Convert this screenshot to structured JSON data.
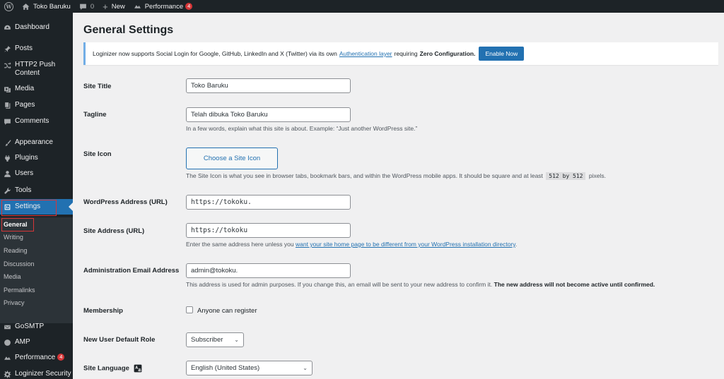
{
  "adminbar": {
    "site_name": "Toko Baruku",
    "comments_count": "0",
    "new_label": "New",
    "performance_label": "Performance",
    "performance_count": "4"
  },
  "sidebar": {
    "dashboard": "Dashboard",
    "posts": "Posts",
    "http2": "HTTP2 Push Content",
    "media": "Media",
    "pages": "Pages",
    "comments": "Comments",
    "appearance": "Appearance",
    "plugins": "Plugins",
    "users": "Users",
    "tools": "Tools",
    "settings": "Settings",
    "submenu": [
      "General",
      "Writing",
      "Reading",
      "Discussion",
      "Media",
      "Permalinks",
      "Privacy"
    ],
    "gosmtp": "GoSMTP",
    "amp": "AMP",
    "performance": "Performance",
    "performance_count": "4",
    "loginizer": "Loginizer Security"
  },
  "page": {
    "title": "General Settings"
  },
  "notice": {
    "text": "Loginizer now supports Social Login for Google, GitHub, LinkedIn and X (Twitter) via its own",
    "link": "Authentication layer",
    "text2": "requiring",
    "bold": "Zero Configuration.",
    "button": "Enable Now"
  },
  "form": {
    "site_title_label": "Site Title",
    "site_title_value": "Toko Baruku",
    "tagline_label": "Tagline",
    "tagline_value": "Telah dibuka Toko Baruku",
    "tagline_desc": "In a few words, explain what this site is about. Example: “Just another WordPress site.”",
    "site_icon_label": "Site Icon",
    "site_icon_button": "Choose a Site Icon",
    "site_icon_desc1": "The Site Icon is what you see in browser tabs, bookmark bars, and within the WordPress mobile apps. It should be square and at least",
    "site_icon_code": "512 by 512",
    "site_icon_desc2": "pixels.",
    "wp_address_label": "WordPress Address (URL)",
    "wp_address_value": "https://tokoku.",
    "site_address_label": "Site Address (URL)",
    "site_address_value": "https://tokoku",
    "site_address_desc1": "Enter the same address here unless you",
    "site_address_link": "want your site home page to be different from your WordPress installation directory",
    "site_address_desc2": ".",
    "admin_email_label": "Administration Email Address",
    "admin_email_value": "admin@tokoku.",
    "admin_email_desc1": "This address is used for admin purposes. If you change this, an email will be sent to your new address to confirm it.",
    "admin_email_bold": "The new address will not become active until confirmed.",
    "membership_label": "Membership",
    "membership_checkbox": "Anyone can register",
    "default_role_label": "New User Default Role",
    "default_role_value": "Subscriber",
    "site_language_label": "Site Language",
    "site_language_value": "English (United States)"
  },
  "colors": {
    "accent": "#2271b1",
    "sidebar_bg": "#1d2327",
    "badge": "#d63638",
    "highlight_box": "#d63638"
  }
}
